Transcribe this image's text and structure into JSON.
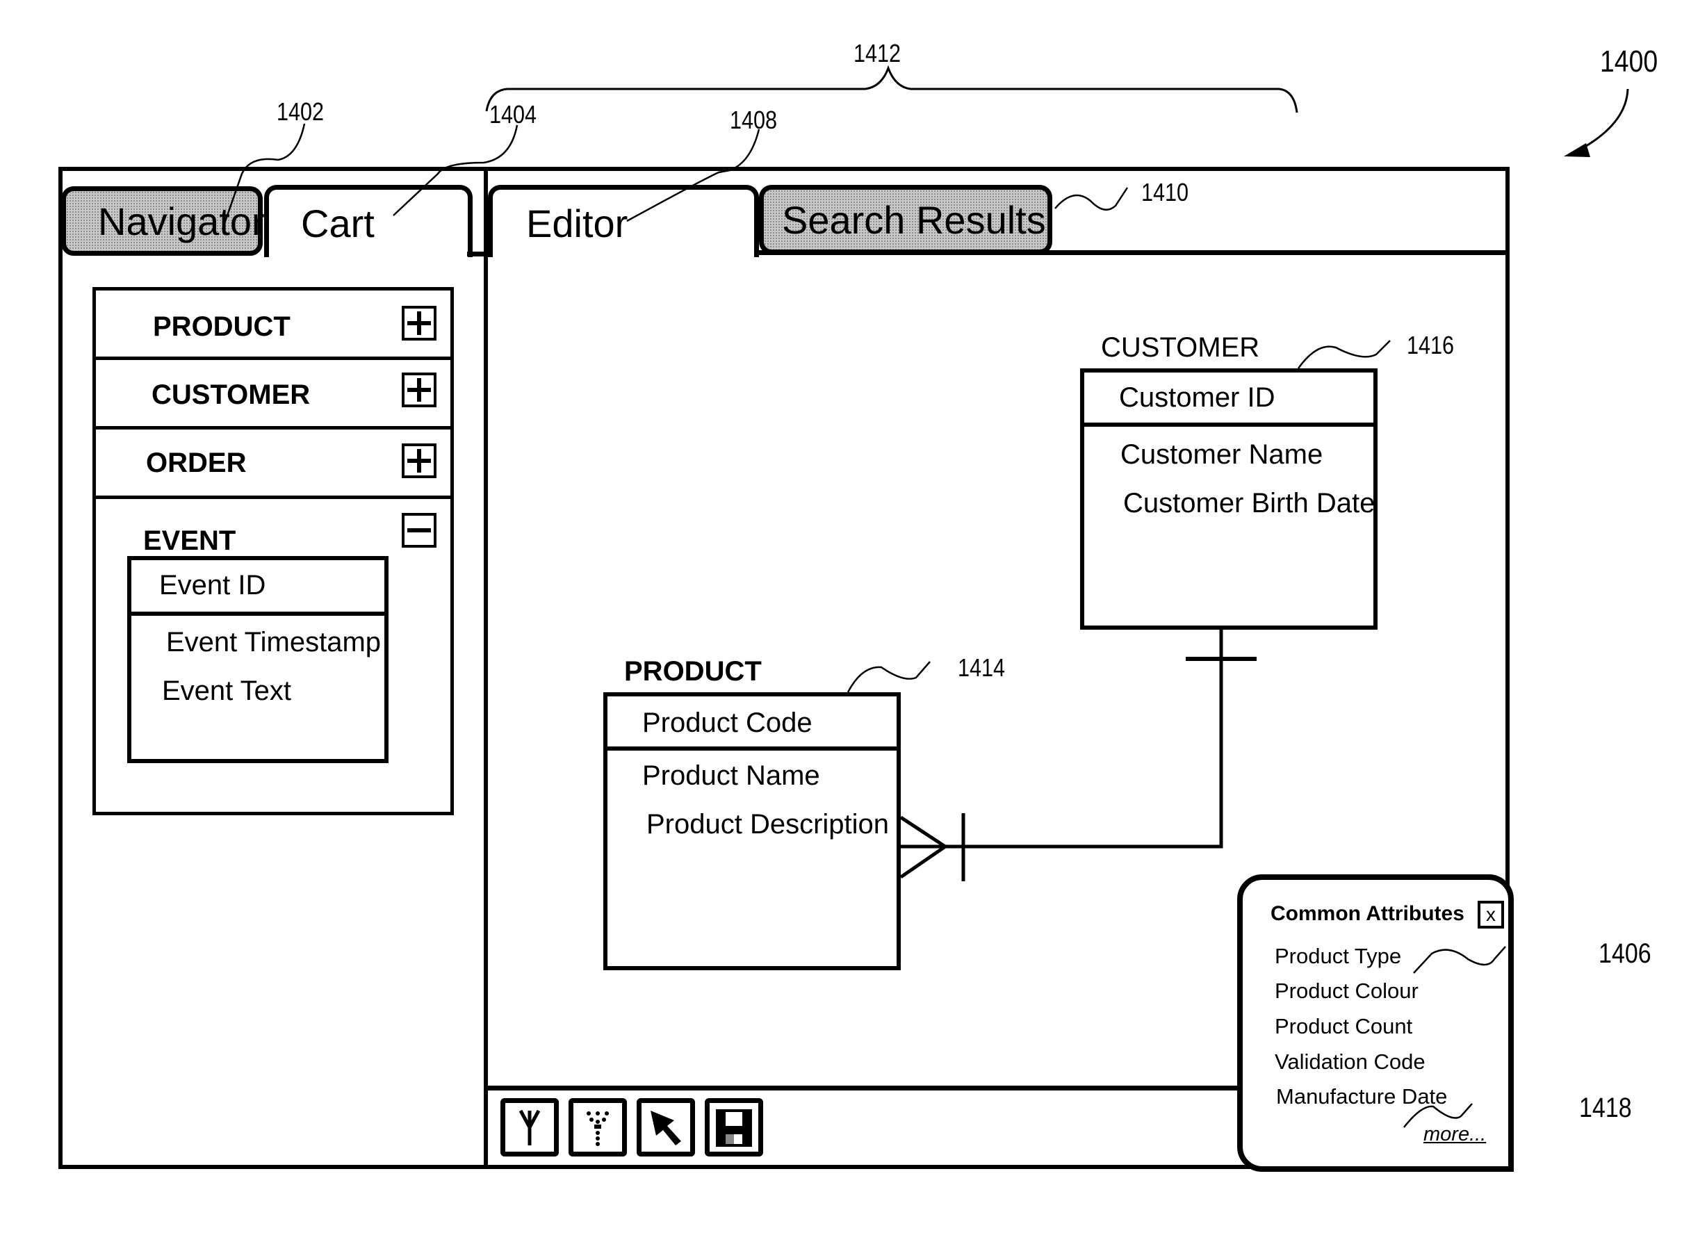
{
  "figure": {
    "ref_main": "1400",
    "ref_navigator_tab": "1402",
    "ref_cart_tab": "1404",
    "ref_common_attributes": "1406",
    "ref_editor_tab": "1408",
    "ref_search_results_tab": "1410",
    "ref_editor_area": "1412",
    "ref_product_entity": "1414",
    "ref_customer_entity": "1416",
    "ref_more_link": "1418"
  },
  "left_panel": {
    "tabs": [
      {
        "label": "Navigator",
        "state": "inactive"
      },
      {
        "label": "Cart",
        "state": "active"
      }
    ],
    "entities": [
      {
        "name": "PRODUCT",
        "expanded": false,
        "toggle_icon": "plus-icon"
      },
      {
        "name": "CUSTOMER",
        "expanded": false,
        "toggle_icon": "plus-icon"
      },
      {
        "name": "ORDER",
        "expanded": false,
        "toggle_icon": "plus-icon"
      },
      {
        "name": "EVENT",
        "expanded": true,
        "toggle_icon": "minus-icon",
        "key_attribute": "Event ID",
        "attributes": [
          "Event Timestamp",
          "Event Text"
        ]
      }
    ]
  },
  "right_panel": {
    "tabs": [
      {
        "label": "Editor",
        "state": "active"
      },
      {
        "label": "Search Results",
        "state": "inactive"
      }
    ],
    "diagram": {
      "customer": {
        "title": "CUSTOMER",
        "key_attribute": "Customer ID",
        "attributes": [
          "Customer Name",
          "Customer Birth Date"
        ]
      },
      "product": {
        "title": "PRODUCT",
        "key_attribute": "Product Code",
        "attributes": [
          "Product Name",
          "Product Description"
        ]
      },
      "relationship": {
        "from": "CUSTOMER",
        "to": "PRODUCT",
        "from_cardinality": "one",
        "to_cardinality": "many"
      }
    },
    "toolbar": [
      {
        "icon": "filter-icon",
        "label": "filter"
      },
      {
        "icon": "filter-dotted-icon",
        "label": "filter-dotted"
      },
      {
        "icon": "pointer-arrow-icon",
        "label": "select"
      },
      {
        "icon": "save-disk-icon",
        "label": "save"
      }
    ],
    "common_attributes": {
      "title": "Common Attributes",
      "close_label": "x",
      "items": [
        "Product Type",
        "Product Colour",
        "Product Count",
        "Validation Code",
        "Manufacture Date"
      ],
      "more_label": "more..."
    }
  }
}
